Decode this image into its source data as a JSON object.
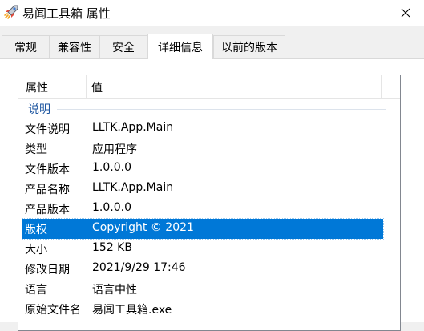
{
  "window": {
    "title": "易闻工具箱 属性",
    "icon": "rocket-icon",
    "close_icon": "close-icon"
  },
  "tabs": [
    {
      "label": "常规",
      "active": false
    },
    {
      "label": "兼容性",
      "active": false
    },
    {
      "label": "安全",
      "active": false
    },
    {
      "label": "详细信息",
      "active": true
    },
    {
      "label": "以前的版本",
      "active": false
    }
  ],
  "details": {
    "columns": [
      "属性",
      "值"
    ],
    "group": "说明",
    "rows": [
      {
        "property": "文件说明",
        "value": "LLTK.App.Main"
      },
      {
        "property": "类型",
        "value": "应用程序"
      },
      {
        "property": "文件版本",
        "value": "1.0.0.0"
      },
      {
        "property": "产品名称",
        "value": "LLTK.App.Main"
      },
      {
        "property": "产品版本",
        "value": "1.0.0.0"
      },
      {
        "property": "版权",
        "value": "Copyright ©  2021",
        "selected": true
      },
      {
        "property": "大小",
        "value": "152 KB"
      },
      {
        "property": "修改日期",
        "value": "2021/9/29 17:46"
      },
      {
        "property": "语言",
        "value": "语言中性"
      },
      {
        "property": "原始文件名",
        "value": "易闻工具箱.exe"
      }
    ]
  },
  "colors": {
    "selection": "#0078d7",
    "group_header": "#1e56a0"
  }
}
